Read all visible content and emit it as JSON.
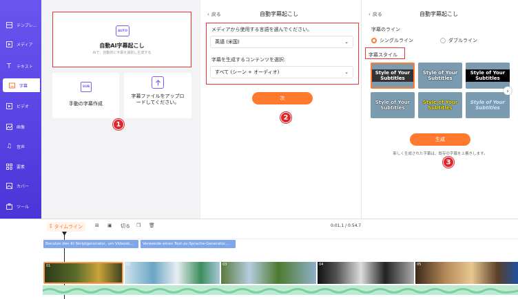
{
  "sidebar": {
    "items": [
      {
        "label": "テンプレ...",
        "icon": "template-icon"
      },
      {
        "label": "メディア",
        "icon": "media-icon"
      },
      {
        "label": "テキスト",
        "icon": "text-icon"
      },
      {
        "label": "字幕",
        "icon": "subtitle-icon"
      },
      {
        "label": "ビデオ",
        "icon": "video-icon"
      },
      {
        "label": "画像",
        "icon": "image-icon"
      },
      {
        "label": "音声",
        "icon": "audio-icon"
      },
      {
        "label": "要素",
        "icon": "elements-icon"
      },
      {
        "label": "カバー",
        "icon": "cover-icon"
      },
      {
        "label": "ツール",
        "icon": "tools-icon"
      }
    ]
  },
  "panel1": {
    "auto_badge": "AUTO",
    "auto_title": "自動AI字幕起こし",
    "auto_desc": "AIで、自動的に字幕を識別し生成する",
    "manual_badge": "SUB",
    "manual_title": "手動の字幕作成",
    "upload_title": "字幕ファイルをアップロードしてください。"
  },
  "panel2": {
    "back": "戻る",
    "title": "自動字幕起こし",
    "lang_label": "メディアから使用する言語を選んでください。",
    "lang_value": "英語 (米国)",
    "content_label": "字幕を生成するコンテンツを選択:",
    "content_value": "すべて (シーン + オーディオ)",
    "next_label": "次"
  },
  "panel3": {
    "back": "戻る",
    "title": "自動字幕起こし",
    "line_label": "字幕のライン",
    "single_line": "シングルライン",
    "double_line": "ダブルライン",
    "style_label": "字幕スタイル",
    "style_tile_text": "Style of Your Subtitles",
    "generate_label": "生成",
    "note": "新しく生成された字幕は、既存の字幕を上書きします。"
  },
  "badges": [
    "1",
    "2",
    "3"
  ],
  "timeline": {
    "tab_label": "タイムライン",
    "split_label": "切る",
    "time_display": "0:01.1 / 0:54.7",
    "clip1": "Benutze den KI-Skriptgenerator, um Videosk...",
    "clip2": "Verwende einen Text-zu-Sprache-Generator,...",
    "thumb_numbers": [
      "01",
      "02",
      "03",
      "04",
      "05"
    ]
  },
  "colors": {
    "accent": "#ff7a2f",
    "sidebar": "#5a43e6",
    "highlight": "#e33333",
    "tile": "#7a9bb0"
  }
}
